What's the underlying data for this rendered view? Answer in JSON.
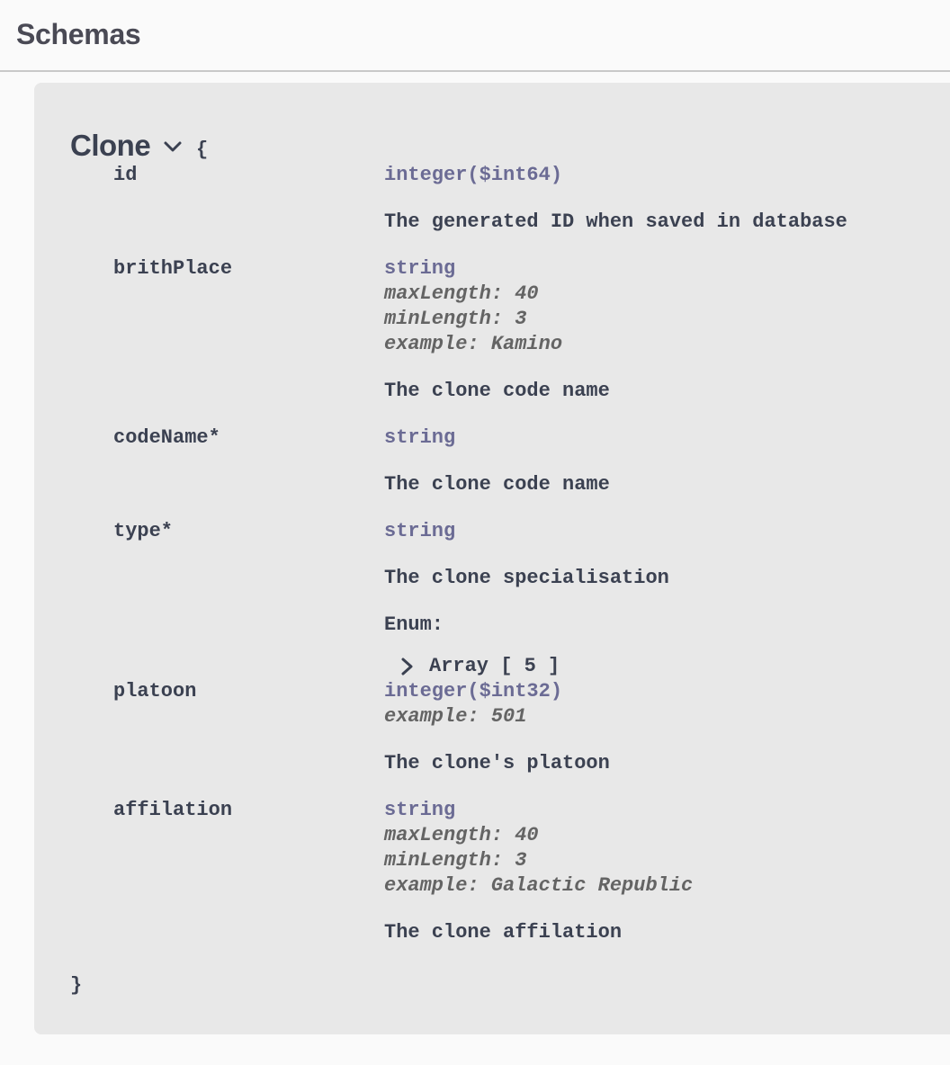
{
  "section": {
    "title": "Schemas"
  },
  "model": {
    "name": "Clone",
    "open_brace": "{",
    "close_brace": "}",
    "properties": [
      {
        "name": "id",
        "type": "integer($int64)",
        "description": "The generated ID when saved in database"
      },
      {
        "name": "brithPlace",
        "type": "string",
        "max_length": "maxLength: 40",
        "min_length": "minLength: 3",
        "example": "example: Kamino",
        "description": "The clone code name"
      },
      {
        "name": "codeName*",
        "type": "string",
        "description": "The clone code name"
      },
      {
        "name": "type*",
        "type": "string",
        "description": "The clone specialisation",
        "enum_label": "Enum:",
        "enum_toggle": "Array [ 5 ]"
      },
      {
        "name": "platoon",
        "type": "integer($int32)",
        "example": "example: 501",
        "description": "The clone's platoon"
      },
      {
        "name": "affilation",
        "type": "string",
        "max_length": "maxLength: 40",
        "min_length": "minLength: 3",
        "example": "example: Galactic Republic",
        "description": "The clone affilation"
      }
    ]
  },
  "icons": {
    "expand": "chevron-down-icon",
    "array": "chevron-right-icon"
  },
  "colors": {
    "page_background": "#fafafa",
    "panel_background": "#e8e8e8",
    "text": "#3b4151",
    "type": "#6b6b94",
    "meta": "#646464"
  }
}
